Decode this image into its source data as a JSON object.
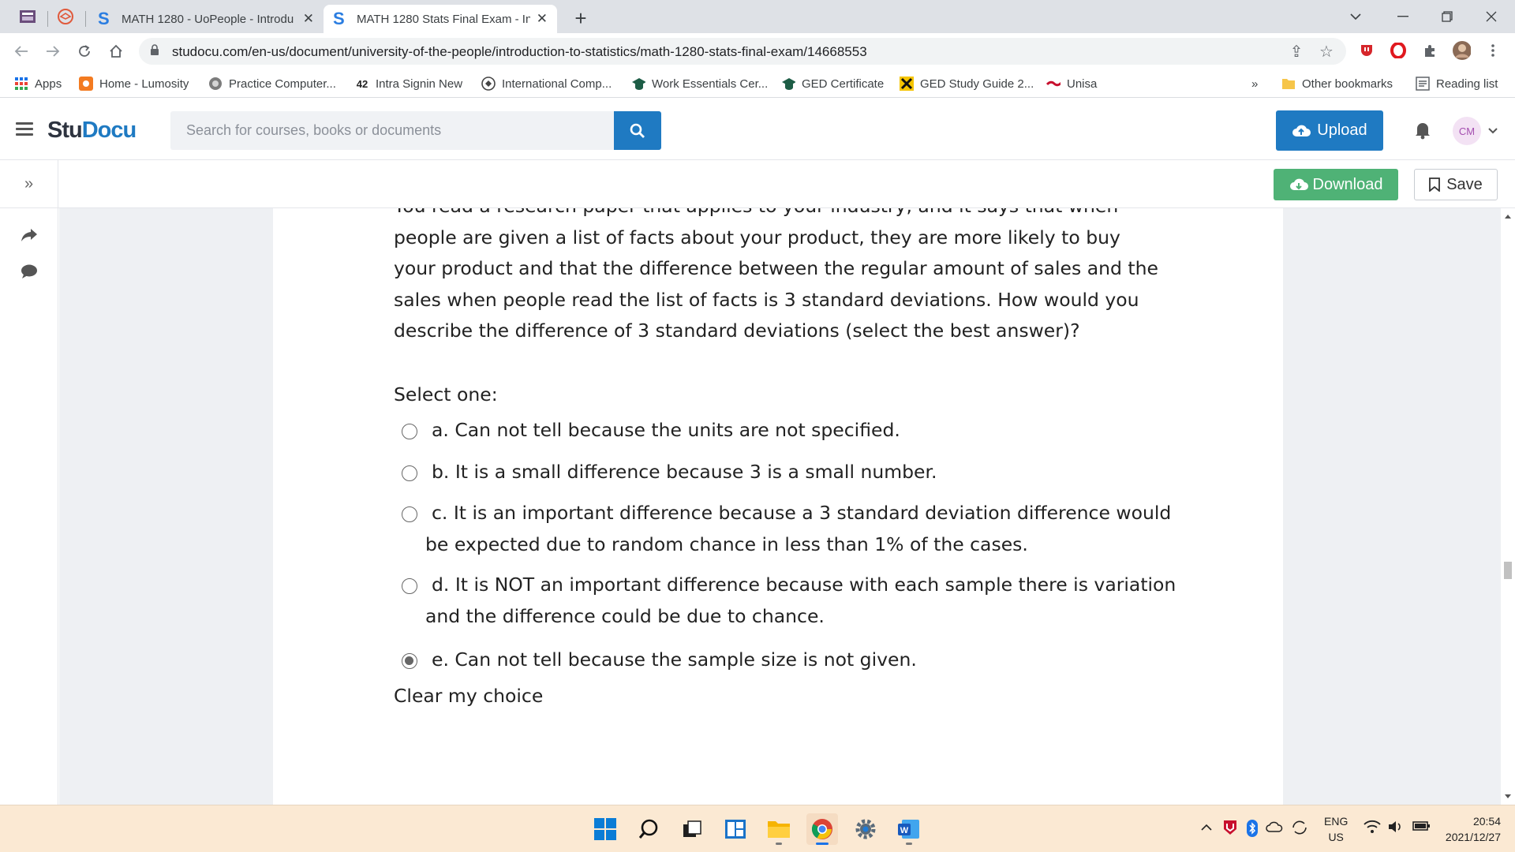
{
  "browser": {
    "tabs": [
      {
        "title": "MATH 1280 - UoPeople - Introdu",
        "active": false
      },
      {
        "title": "MATH 1280 Stats Final Exam - Int",
        "active": true
      }
    ],
    "url": "studocu.com/en-us/document/university-of-the-people/introduction-to-statistics/math-1280-stats-final-exam/14668553",
    "bookmarks": [
      {
        "label": "Apps",
        "icon": "apps-grid-icon"
      },
      {
        "label": "Home - Lumosity",
        "icon": "lumosity-icon"
      },
      {
        "label": "Practice Computer...",
        "icon": "globe-icon"
      },
      {
        "label": "Intra Signin New",
        "icon": "intra-icon"
      },
      {
        "label": "International Comp...",
        "icon": "globe-icon"
      },
      {
        "label": "Work Essentials Cer...",
        "icon": "graduation-cap-icon"
      },
      {
        "label": "GED Certificate",
        "icon": "graduation-cap-icon"
      },
      {
        "label": "GED Study Guide 2...",
        "icon": "ged-icon"
      },
      {
        "label": "Unisa",
        "icon": "unisa-icon"
      }
    ],
    "bookmarks_overflow": "»",
    "other_bookmarks": "Other bookmarks",
    "reading_list": "Reading list",
    "profile_initials": ""
  },
  "studocu": {
    "logo_stu": "Stu",
    "logo_docu": "Docu",
    "search_placeholder": "Search for courses, books or documents",
    "upload_label": "Upload",
    "avatar_initials": "CM",
    "download_label": "Download",
    "save_label": "Save",
    "expand_label": "»"
  },
  "document": {
    "question": "You read a research paper that applies to your industry, and it says that when people are given a list of facts about your product, they are more likely to buy your product and that the difference between the regular amount of sales and the sales when people read the list of facts is 3 standard deviations.  How would you describe the difference of 3 standard deviations (select the best answer)?",
    "select_prompt": "Select one:",
    "options": [
      {
        "text": "a. Can not tell because the units are not specified.",
        "checked": false
      },
      {
        "text": "b. It is a small difference because 3 is a small number.",
        "checked": false
      },
      {
        "text": "c. It is an important difference because a 3 standard deviation difference would be expected due to random chance in less than 1% of the cases.",
        "checked": false
      },
      {
        "text": "d. It is NOT an important difference because with each sample there is variation and the difference could be due to chance.",
        "checked": false
      },
      {
        "text": "e. Can not tell because the sample size is not given.",
        "checked": true
      }
    ],
    "clear_choice": "Clear my choice"
  },
  "taskbar": {
    "apps": [
      "windows-start-icon",
      "search-icon",
      "task-view-icon",
      "widgets-icon",
      "file-explorer-icon",
      "chrome-icon",
      "settings-icon",
      "word-icon"
    ],
    "lang_top": "ENG",
    "lang_bottom": "US",
    "time": "20:54",
    "date": "2021/12/27"
  },
  "colors": {
    "brand_blue": "#1f7ac2",
    "download_green": "#4fb276",
    "taskbar_bg": "#fbe9d3"
  }
}
